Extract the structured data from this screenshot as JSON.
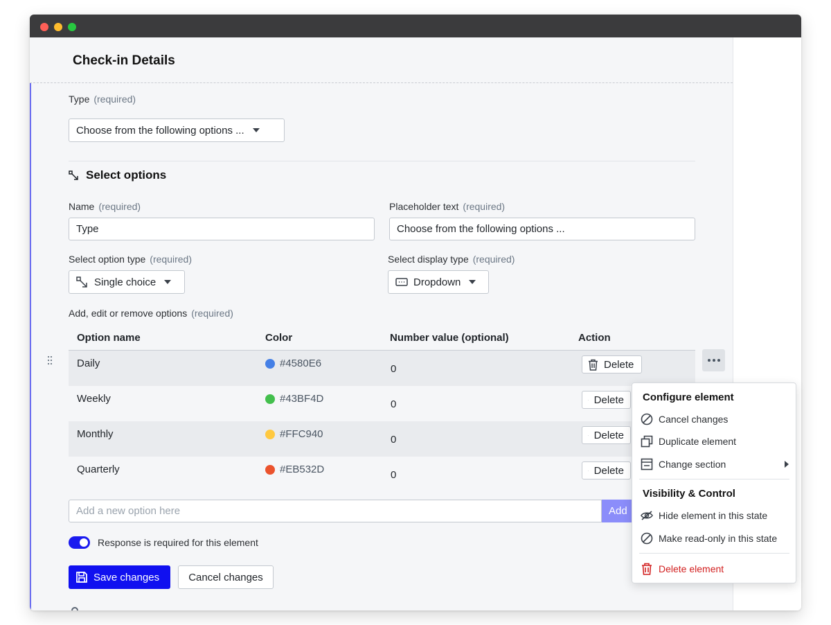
{
  "header": {
    "title": "Check-in Details"
  },
  "type_field": {
    "label": "Type",
    "required": "(required)",
    "selected": "Choose from the following options ..."
  },
  "section": {
    "title": "Select options"
  },
  "name_field": {
    "label": "Name",
    "required": "(required)",
    "value": "Type"
  },
  "placeholder_field": {
    "label": "Placeholder text",
    "required": "(required)",
    "value": "Choose from the following options ..."
  },
  "option_type": {
    "label": "Select option type",
    "required": "(required)",
    "selected": "Single choice"
  },
  "display_type": {
    "label": "Select display type",
    "required": "(required)",
    "selected": "Dropdown"
  },
  "options_table": {
    "label": "Add, edit or remove options",
    "required": "(required)",
    "headers": [
      "Option name",
      "Color",
      "Number value (optional)",
      "Action"
    ],
    "rows": [
      {
        "name": "Daily",
        "color": "#4580E6",
        "value": "0",
        "action": "Delete"
      },
      {
        "name": "Weekly",
        "color": "#43BF4D",
        "value": "0",
        "action": "Delete"
      },
      {
        "name": "Monthly",
        "color": "#FFC940",
        "value": "0",
        "action": "Delete"
      },
      {
        "name": "Quarterly",
        "color": "#EB532D",
        "value": "0",
        "action": "Delete"
      }
    ]
  },
  "add_option": {
    "placeholder": "Add a new option here",
    "button": "Add"
  },
  "required_toggle": {
    "label": "Response is required for this element",
    "on": true
  },
  "actions": {
    "save": "Save changes",
    "cancel": "Cancel changes"
  },
  "context_menu": {
    "configure_heading": "Configure element",
    "configure_items": [
      "Cancel changes",
      "Duplicate element",
      "Change section"
    ],
    "visibility_heading": "Visibility & Control",
    "visibility_items": [
      "Hide element in this state",
      "Make read-only in this state"
    ],
    "delete": "Delete element"
  },
  "colors": {
    "accent": "#1010F0",
    "delete": "#D21F1F"
  },
  "icons": [
    "drag-handle-icon",
    "trash-icon",
    "more-icon",
    "save-icon",
    "ban-icon",
    "duplicate-icon",
    "section-icon",
    "eye-off-icon",
    "select-option-icon",
    "dropdown-icon"
  ]
}
